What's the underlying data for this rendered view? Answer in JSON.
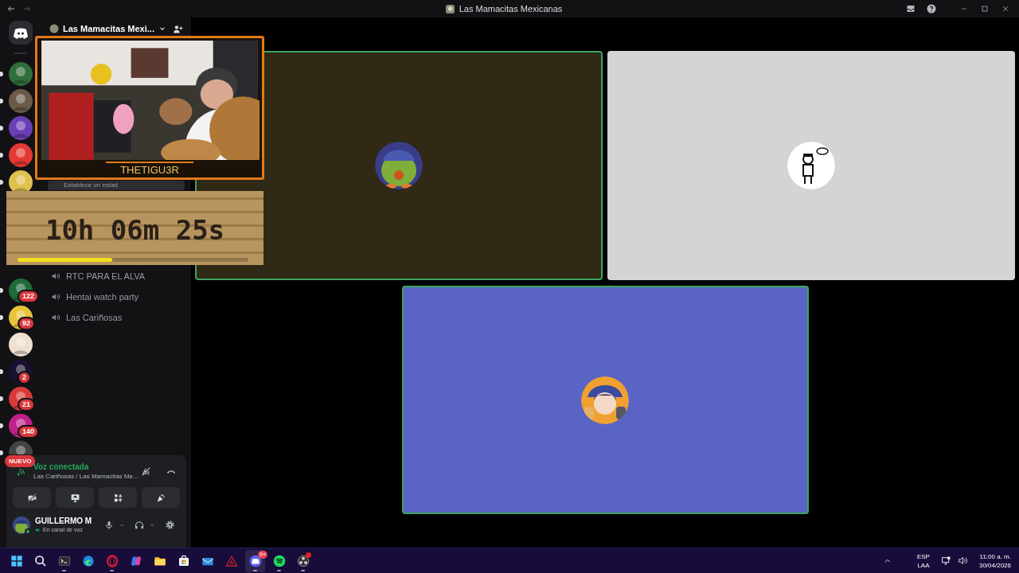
{
  "window": {
    "title": "Las Mamacitas Mexicanas"
  },
  "server_groups": [
    [
      {
        "kind": "home",
        "color": "#2b2d31",
        "unread": false,
        "selected": false
      }
    ],
    [
      {
        "kind": "server",
        "color": "#2f6e3a",
        "unread": true,
        "selected": false
      },
      {
        "kind": "server",
        "color": "#6b5a4a",
        "unread": true,
        "selected": false
      },
      {
        "kind": "server",
        "color": "#6a3fb5",
        "unread": true,
        "selected": false
      },
      {
        "kind": "server",
        "color": "#e53935",
        "unread": true,
        "selected": false
      },
      {
        "kind": "server",
        "color": "#e0c050",
        "unread": true,
        "selected": false
      }
    ],
    [
      {
        "kind": "server",
        "color": "#1f6b3a",
        "unread": true,
        "selected": false,
        "badge": "122"
      },
      {
        "kind": "server",
        "color": "#e8c43a",
        "unread": true,
        "selected": false,
        "badge": "92"
      },
      {
        "kind": "server",
        "color": "#f0e0d0",
        "unread": false,
        "selected": false
      },
      {
        "kind": "server",
        "color": "#1a1030",
        "unread": true,
        "selected": false,
        "badge": "2"
      },
      {
        "kind": "server",
        "color": "#d83a3a",
        "unread": true,
        "selected": false,
        "badge": "21"
      },
      {
        "kind": "server",
        "color": "#c0208a",
        "unread": true,
        "selected": false,
        "badge": "140"
      },
      {
        "kind": "server",
        "color": "#444444",
        "unread": true,
        "selected": false,
        "tag": "NUEVO"
      }
    ]
  ],
  "server_header": {
    "name": "Las Mamacitas Mexi..."
  },
  "status_field": {
    "placeholder": "Establece un estad"
  },
  "channels": [
    {
      "name": "RTC PARA EL ALVA"
    },
    {
      "name": "Hentai watch party"
    },
    {
      "name": "Las Cariñosas"
    }
  ],
  "voice_panel": {
    "status": "Voz conectada",
    "location": "Las Cariñosas / Las Mamacitas Me..."
  },
  "user": {
    "name": "GUILLERMO M",
    "status": "En canal de voz"
  },
  "tiles": [
    {
      "color": "#2f2916",
      "speaking": true
    },
    {
      "color": "#d5d4d5",
      "speaking": false
    },
    {
      "color": "#5964c4",
      "speaking": true
    }
  ],
  "stream_overlay": {
    "streamer": "THETIGU3R",
    "timer": "10h 06m 25s",
    "level": 0.41
  },
  "taskbar": {
    "apps": [
      {
        "kind": "start",
        "running": false,
        "active": false
      },
      {
        "kind": "search",
        "running": false,
        "active": false
      },
      {
        "kind": "terminal",
        "running": true,
        "active": false
      },
      {
        "kind": "edge",
        "running": false,
        "active": false
      },
      {
        "kind": "opera",
        "running": true,
        "active": false
      },
      {
        "kind": "copilot",
        "running": false,
        "active": false
      },
      {
        "kind": "folder",
        "running": false,
        "active": false
      },
      {
        "kind": "store",
        "running": false,
        "active": false
      },
      {
        "kind": "mail",
        "running": false,
        "active": false
      },
      {
        "kind": "triangle",
        "running": false,
        "active": false
      },
      {
        "kind": "discord",
        "running": true,
        "active": true,
        "badge": "9+"
      },
      {
        "kind": "spotify",
        "running": true,
        "active": false
      },
      {
        "kind": "obs",
        "running": true,
        "active": false,
        "alert": true
      }
    ],
    "language": "ESP",
    "layout": "LAA",
    "time": "11:00 a. m.",
    "date": "30/04/2026"
  }
}
